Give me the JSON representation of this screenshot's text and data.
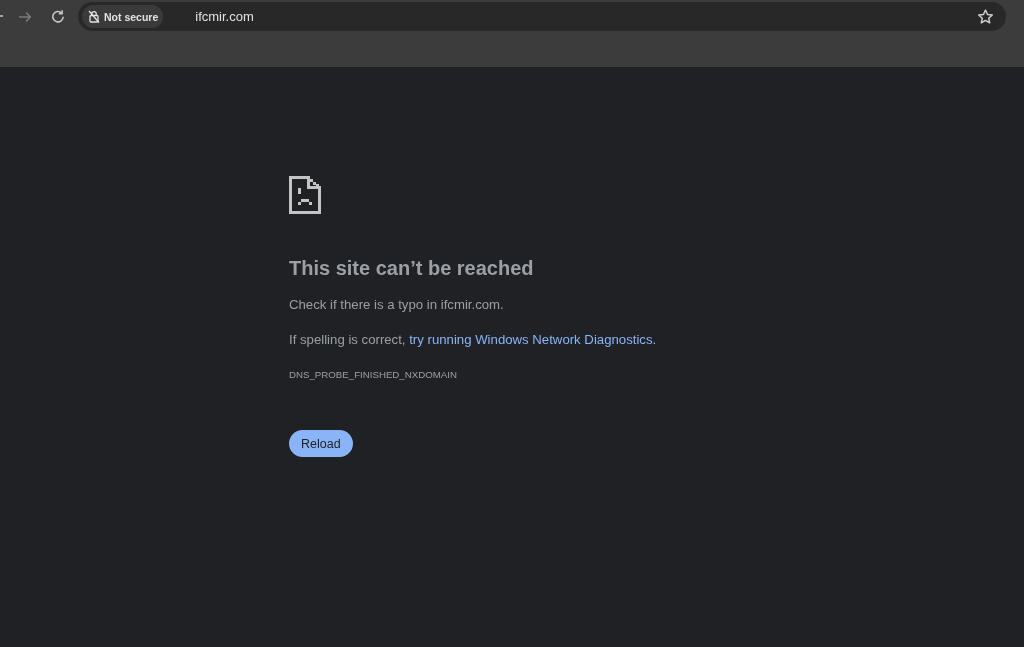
{
  "toolbar": {
    "back": {
      "disabled": false
    },
    "forward": {
      "disabled": true
    }
  },
  "address_bar": {
    "security_chip": "Not secure",
    "url": "ifcmir.com"
  },
  "error_page": {
    "title": "This site can’t be reached",
    "paragraphs": [
      {
        "kind": "text",
        "text": "Check if there is a typo in ifcmir.com."
      },
      {
        "kind": "link_sentence",
        "text": "If spelling is correct, ",
        "link": "try running Windows Network Diagnostics."
      }
    ],
    "error_code": "DNS_PROBE_FINISHED_NXDOMAIN",
    "button": "Reload"
  }
}
